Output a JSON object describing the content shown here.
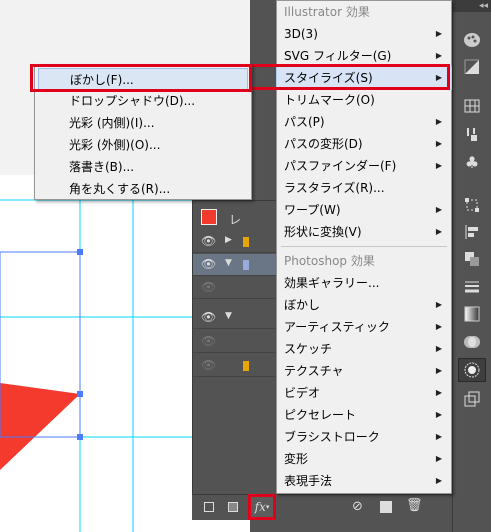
{
  "effect_menu": {
    "illustrator_header": "Illustrator 効果",
    "illustrator_items": [
      {
        "label": "3D(3)",
        "submenu": true
      },
      {
        "label": "SVG フィルター(G)",
        "submenu": true
      },
      {
        "label": "スタイライズ(S)",
        "submenu": true
      },
      {
        "label": "トリムマーク(O)",
        "submenu": false
      },
      {
        "label": "パス(P)",
        "submenu": true
      },
      {
        "label": "パスの変形(D)",
        "submenu": true
      },
      {
        "label": "パスファインダー(F)",
        "submenu": true
      },
      {
        "label": "ラスタライズ(R)...",
        "submenu": false
      },
      {
        "label": "ワープ(W)",
        "submenu": true
      },
      {
        "label": "形状に変換(V)",
        "submenu": true
      }
    ],
    "photoshop_header": "Photoshop 効果",
    "photoshop_items": [
      {
        "label": "効果ギャラリー...",
        "submenu": false
      },
      {
        "label": "ぼかし",
        "submenu": true
      },
      {
        "label": "アーティスティック",
        "submenu": true
      },
      {
        "label": "スケッチ",
        "submenu": true
      },
      {
        "label": "テクスチャ",
        "submenu": true
      },
      {
        "label": "ビデオ",
        "submenu": true
      },
      {
        "label": "ピクセレート",
        "submenu": true
      },
      {
        "label": "ブラシストローク",
        "submenu": true
      },
      {
        "label": "変形",
        "submenu": true
      },
      {
        "label": "表現手法",
        "submenu": true
      }
    ]
  },
  "stylize_submenu": {
    "items": [
      "ぼかし(F)...",
      "ドロップシャドウ(D)...",
      "光彩 (内側)(I)...",
      "光彩 (外側)(O)...",
      "落書き(B)...",
      "角を丸くする(R)..."
    ]
  },
  "layers_panel": {
    "tab_initial": "レ",
    "fx_button_label": "fx"
  },
  "colors": {
    "highlight_border": "#e0001c",
    "shape_fill": "#f4392d",
    "guide": "#00d7ff",
    "selection_path": "#4a7cff"
  },
  "icons": [
    "paint-palette-icon",
    "brush-icon",
    "gradient-swatch-icon",
    "grid-icon",
    "brushes-icon",
    "club-symbol-icon",
    "transform-icon",
    "align-icon",
    "pathfinder-icon",
    "stroke-icon",
    "gradient-icon",
    "transparency-icon",
    "appearance-icon",
    "layers-export-icon"
  ]
}
